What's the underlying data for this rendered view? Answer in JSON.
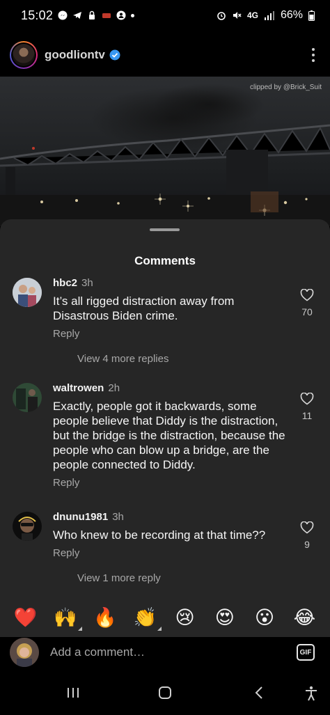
{
  "status_bar": {
    "time": "15:02",
    "network": "4G",
    "battery": "66%"
  },
  "header": {
    "username": "goodliontv",
    "verified_color": "#3897f0"
  },
  "video": {
    "credit": "clipped by @Brick_Suit"
  },
  "comments_sheet": {
    "title": "Comments",
    "comments": [
      {
        "user": "hbc2",
        "time": "3h",
        "text": "It’s all rigged distraction away from Disastrous Biden crime.",
        "reply_label": "Reply",
        "likes": "70",
        "view_more": "View 4 more replies"
      },
      {
        "user": "waltrowen",
        "time": "2h",
        "text": "Exactly, people got it backwards, some people believe that Diddy is the distraction, but the bridge is the distraction, because the people who can blow up a bridge, are the people connected to Diddy.",
        "reply_label": "Reply",
        "likes": "11"
      },
      {
        "user": "dnunu1981",
        "time": "3h",
        "text": "Who knew to be recording at that time??",
        "reply_label": "Reply",
        "likes": "9",
        "view_more": "View 1 more reply"
      }
    ],
    "emojis": [
      "❤️",
      "🙌",
      "🔥",
      "👏",
      "😢",
      "😍",
      "😮",
      "😂"
    ],
    "input_placeholder": "Add a comment…",
    "gif_label": "GIF"
  },
  "colors": {
    "sheet_bg": "#262626",
    "muted_text": "#a8a8a8"
  }
}
